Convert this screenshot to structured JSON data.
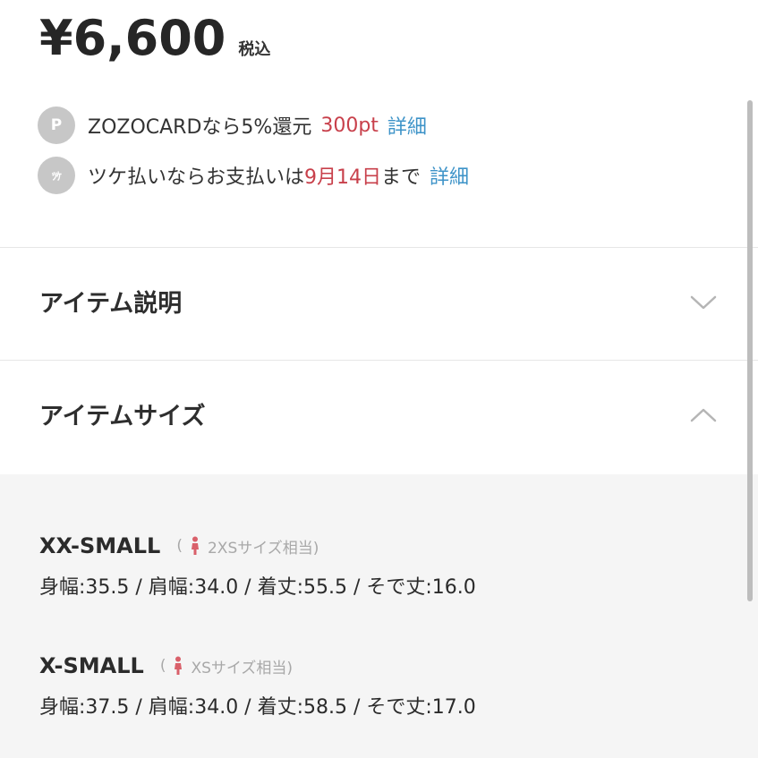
{
  "price": {
    "amount": "¥6,600",
    "tax_label": "税込"
  },
  "benefits": [
    {
      "badge": "P",
      "text": "ZOZOCARDなら5%還元",
      "highlight": "300pt",
      "link": "詳細"
    },
    {
      "badge": "ﾂｹ",
      "text_before": "ツケ払いならお支払いは",
      "highlight": "9月14日",
      "text_after": "まで",
      "link": "詳細"
    }
  ],
  "accordions": [
    {
      "title": "アイテム説明",
      "state": "collapsed",
      "icon": "chevron-down-icon"
    },
    {
      "title": "アイテムサイズ",
      "state": "expanded",
      "icon": "chevron-up-icon"
    }
  ],
  "sizes": [
    {
      "name": "XX-SMALL",
      "equivalent_open": "(",
      "equivalent": "2XSサイズ相当)",
      "measurements": "身幅:35.5 / 肩幅:34.0 / 着丈:55.5 / そで丈:16.0"
    },
    {
      "name": "X-SMALL",
      "equivalent_open": "(",
      "equivalent": "XSサイズ相当)",
      "measurements": "身幅:37.5 / 肩幅:34.0 / 着丈:58.5 / そで丈:17.0"
    }
  ],
  "colors": {
    "accent_red": "#c8404b",
    "link_blue": "#3d93c8",
    "badge_gray": "#c7c7c7",
    "panel_bg": "#f5f5f5",
    "person_icon": "#d9606a"
  }
}
